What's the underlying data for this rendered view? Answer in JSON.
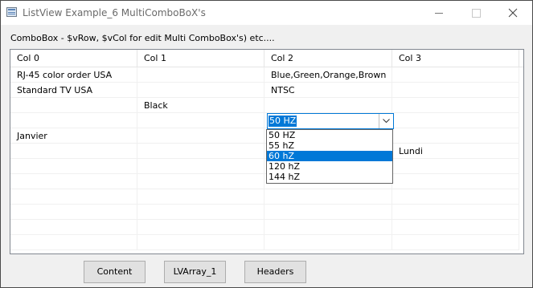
{
  "window": {
    "title": "ListView Example_6 MultiComboBoX's"
  },
  "caption": "ComboBox  - $vRow, $vCol for edit Multi ComboBox's) etc....",
  "listview": {
    "columns": [
      "Col 0",
      "Col 1",
      "Col 2",
      "Col 3"
    ],
    "rows": [
      [
        "RJ-45 color order USA",
        "",
        "Blue,Green,Orange,Brown",
        ""
      ],
      [
        "Standard TV USA",
        "",
        "NTSC",
        ""
      ],
      [
        "",
        "Black",
        "",
        ""
      ],
      [
        "",
        "",
        "",
        ""
      ],
      [
        "Janvier",
        "",
        "",
        ""
      ],
      [
        "",
        "",
        "",
        "Lundi"
      ],
      [
        "",
        "",
        "",
        ""
      ],
      [
        "",
        "",
        "",
        ""
      ],
      [
        "",
        "",
        "",
        ""
      ],
      [
        "",
        "",
        "",
        ""
      ],
      [
        "",
        "",
        "",
        ""
      ],
      [
        "",
        "",
        "",
        ""
      ]
    ]
  },
  "combo": {
    "value": "50 HZ",
    "options": [
      "50 HZ",
      "55 hZ",
      "60 hZ",
      "120 hZ",
      "144 hZ"
    ],
    "selected_index": 2
  },
  "buttons": {
    "content": "Content",
    "lvarray": "LVArray_1",
    "headers": "Headers"
  },
  "icons": {
    "app": "listview-app-icon",
    "minimize": "minimize-icon",
    "maximize": "maximize-icon",
    "close": "close-icon",
    "dropdown": "chevron-down-icon"
  }
}
